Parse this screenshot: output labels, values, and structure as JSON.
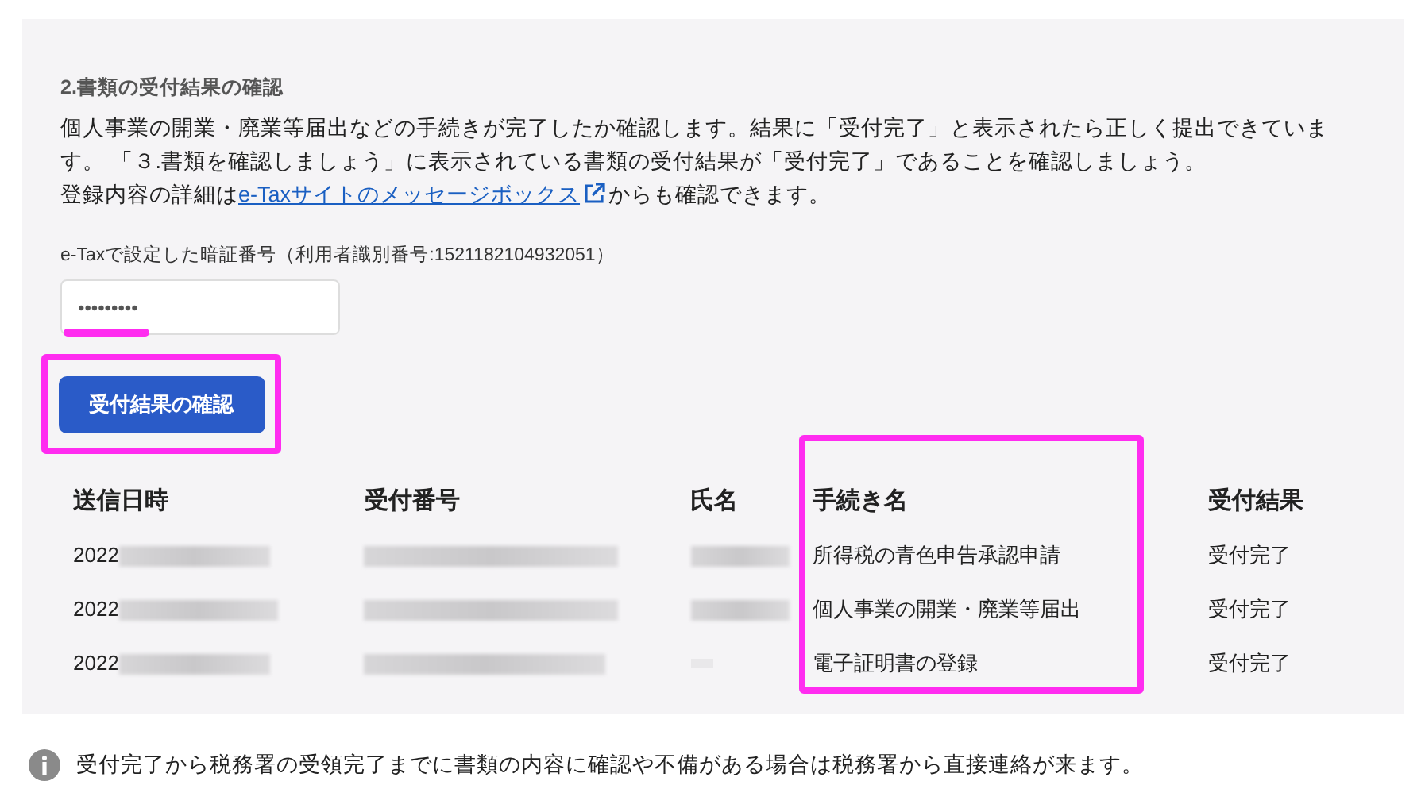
{
  "section": {
    "title": "2.書類の受付結果の確認",
    "paragraph": "個人事業の開業・廃業等届出などの手続きが完了したか確認します。結果に「受付完了」と表示されたら正しく提出できています。 「３.書類を確認しましょう」に表示されている書類の受付結果が「受付完了」であることを確認しましょう。",
    "detail_before": "登録内容の詳細は",
    "detail_link": "e-Taxサイトのメッセージボックス",
    "detail_after": "からも確認できます。",
    "field_label": "e-Taxで設定した暗証番号（利用者識別番号:1521182104932051）",
    "password_value": "•••••••••",
    "button": "受付結果の確認",
    "table": {
      "columns": [
        "送信日時",
        "受付番号",
        "氏名",
        "手続き名",
        "受付結果"
      ],
      "rows": [
        {
          "date": "2022",
          "name_redacted": true,
          "procedure": "所得税の青色申告承認申請",
          "result": "受付完了"
        },
        {
          "date": "2022",
          "name_redacted": true,
          "procedure": "個人事業の開業・廃業等届出",
          "result": "受付完了"
        },
        {
          "date": "2022",
          "name_redacted": false,
          "procedure": "電子証明書の登録",
          "result": "受付完了"
        }
      ]
    }
  },
  "note": "受付完了から税務署の受領完了までに書類の内容に確認や不備がある場合は税務署から直接連絡が来ます。"
}
